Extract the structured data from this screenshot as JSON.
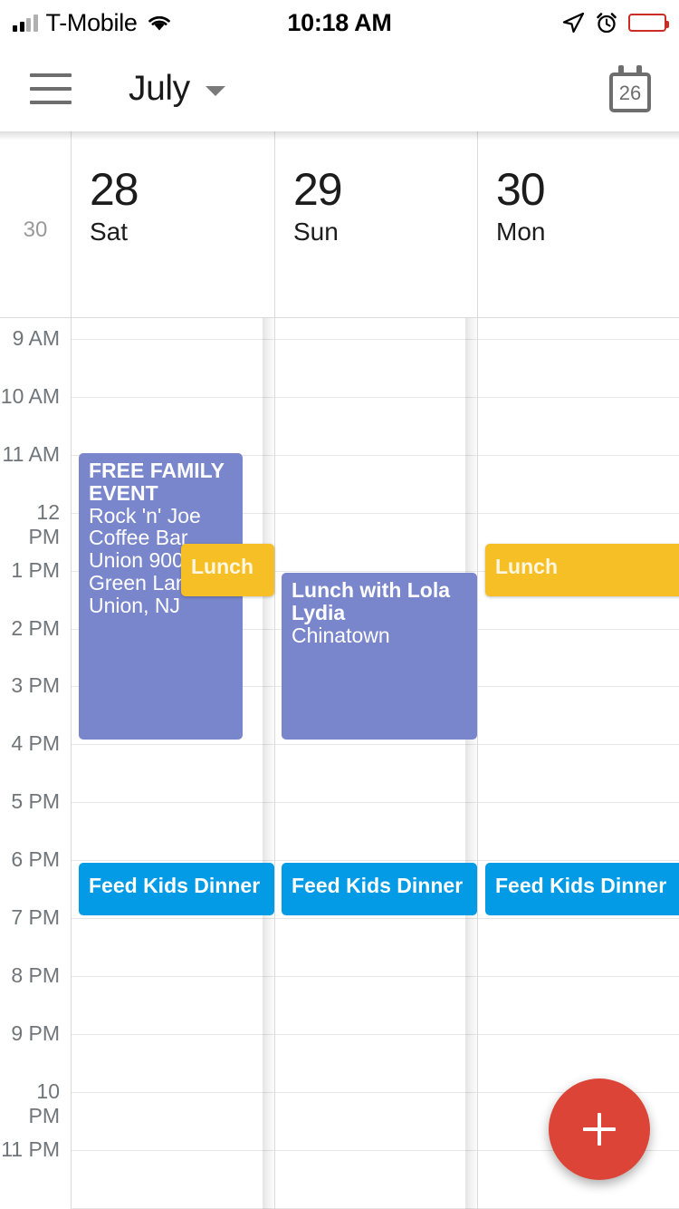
{
  "status_bar": {
    "carrier": "T-Mobile",
    "time": "10:18 AM",
    "signal_icon": "signal-bars-icon",
    "wifi_icon": "wifi-icon",
    "location_icon": "location-arrow-icon",
    "alarm_icon": "alarm-clock-icon",
    "battery_icon": "battery-low-icon",
    "battery_color": "#e8392f"
  },
  "app_bar": {
    "menu_icon": "hamburger-menu-icon",
    "title": "July",
    "dropdown_icon": "chevron-down-icon",
    "today_icon": "calendar-icon",
    "today_date": "26"
  },
  "day_header": {
    "gutter_label": "30",
    "days": [
      {
        "date": "28",
        "dow": "Sat"
      },
      {
        "date": "29",
        "dow": "Sun"
      },
      {
        "date": "30",
        "dow": "Mon"
      }
    ]
  },
  "time_labels": [
    "9 AM",
    "10 AM",
    "11 AM",
    "12 PM",
    "1 PM",
    "2 PM",
    "3 PM",
    "4 PM",
    "5 PM",
    "6 PM",
    "7 PM",
    "8 PM",
    "9 PM",
    "10 PM",
    "11 PM"
  ],
  "colors": {
    "event_purple": "#7986CB",
    "event_blue": "#039BE5",
    "event_amber": "#F6BF26",
    "fab_red": "#DB4437",
    "grid_line": "#E6E6E6",
    "divider": "#DADADA",
    "time_text": "#70757A"
  },
  "events": [
    {
      "id": "free-family-event",
      "day": "Sat 28",
      "title": "FREE FAMILY EVENT",
      "location": "Rock 'n' Joe Coffee Bar Union 900 Green Lane Union, NJ",
      "color": "purple"
    },
    {
      "id": "lunch-sat",
      "day": "Sat 28",
      "title": "Lunch",
      "location": "",
      "color": "amber"
    },
    {
      "id": "lunch-with-lola-lydia",
      "day": "Sun 29",
      "title": "Lunch with Lola Lydia",
      "location": "Chinatown",
      "color": "purple"
    },
    {
      "id": "lunch-mon",
      "day": "Mon 30",
      "title": "Lunch",
      "location": "",
      "color": "amber"
    },
    {
      "id": "feed-kids-dinner-sat",
      "day": "Sat 28",
      "title": "Feed Kids Dinner",
      "location": "",
      "color": "blue"
    },
    {
      "id": "feed-kids-dinner-sun",
      "day": "Sun 29",
      "title": "Feed Kids Dinner",
      "location": "",
      "color": "blue"
    },
    {
      "id": "feed-kids-dinner-mon",
      "day": "Mon 30",
      "title": "Feed Kids Dinner",
      "location": "",
      "color": "blue"
    }
  ],
  "fab": {
    "icon": "plus-icon",
    "label": "Create event"
  }
}
